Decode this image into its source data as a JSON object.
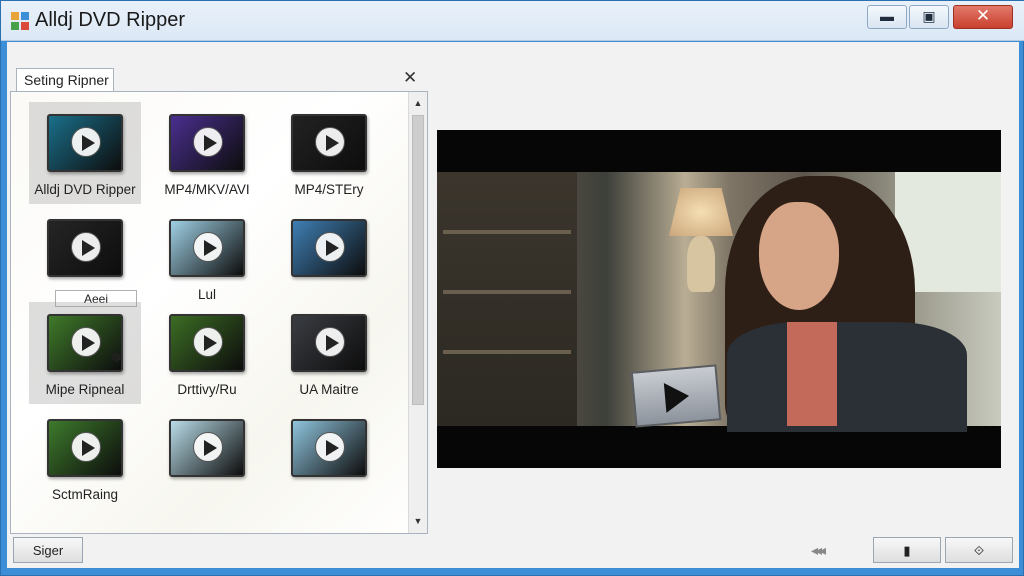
{
  "window": {
    "title": "Alldj DVD Ripper",
    "min_glyph": "▬",
    "max_glyph": "▣",
    "close_glyph": "✕",
    "accent": "#3c8fd6",
    "close_color": "#c9402e"
  },
  "panel": {
    "tab_label": "Seting Ripner",
    "close_glyph": "✕",
    "items": [
      {
        "label": "Alldj DVD Ripper",
        "color": "#1a6f8a",
        "selected": true
      },
      {
        "label": "MP4/MKV/AVI",
        "color": "#4a2f8f",
        "selected": false
      },
      {
        "label": "MP4/STEry",
        "color": "#222222",
        "selected": false
      },
      {
        "label": "Aeei",
        "color": "#252525",
        "selected": false
      },
      {
        "label": "Lul",
        "color": "#9fd0e4",
        "selected": false
      },
      {
        "label": "",
        "color": "#3f7fb4",
        "selected": false
      },
      {
        "label": "Mipe Ripneal",
        "color": "#3f7a2a",
        "selected": true
      },
      {
        "label": "Drttivy/Ru",
        "color": "#3c6d24",
        "selected": false
      },
      {
        "label": "UA Maitre",
        "color": "#3a3d42",
        "selected": false
      },
      {
        "label": "SctmRaing",
        "color": "#3d7a2c",
        "selected": false
      },
      {
        "label": "",
        "color": "#b9dce8",
        "selected": false
      },
      {
        "label": "",
        "color": "#8fc4dd",
        "selected": false
      }
    ],
    "badge_glyph": "✽",
    "scroll_up": "▲",
    "scroll_down": "▼"
  },
  "footer": {
    "signer_button": "Siger",
    "transport_glyph": "◂◂◂",
    "button_a_glyph": "▮",
    "button_b_glyph": "⟐"
  }
}
